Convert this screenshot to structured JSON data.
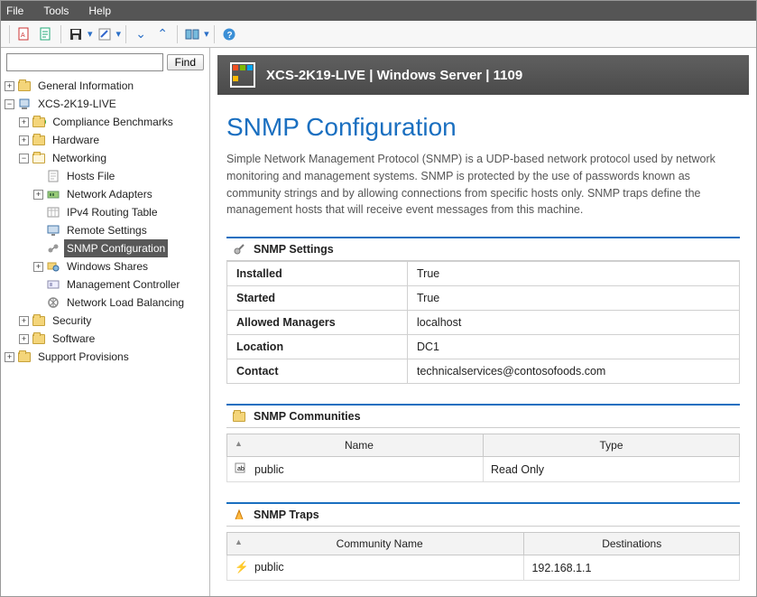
{
  "menu": {
    "file": "File",
    "tools": "Tools",
    "help": "Help"
  },
  "search": {
    "placeholder": "",
    "find_label": "Find"
  },
  "tree": {
    "general_info": "General Information",
    "host": "XCS-2K19-LIVE",
    "compliance": "Compliance Benchmarks",
    "hardware": "Hardware",
    "networking": "Networking",
    "hosts_file": "Hosts File",
    "net_adapters": "Network Adapters",
    "ipv4_routing": "IPv4 Routing Table",
    "remote_settings": "Remote Settings",
    "snmp_config": "SNMP Configuration",
    "windows_shares": "Windows Shares",
    "mgmt_controller": "Management Controller",
    "nlb": "Network Load Balancing",
    "security": "Security",
    "software": "Software",
    "support": "Support Provisions"
  },
  "header": {
    "title": "XCS-2K19-LIVE | Windows Server | 1109"
  },
  "page": {
    "title": "SNMP Configuration",
    "description": "Simple Network Management Protocol (SNMP) is a UDP-based network protocol used by network monitoring and management systems. SNMP is protected by the use of passwords known as community strings and by allowing connections from specific hosts only. SNMP traps define the management hosts that will receive event messages from this machine."
  },
  "settings_section": {
    "title": "SNMP Settings",
    "rows": {
      "installed_k": "Installed",
      "installed_v": "True",
      "started_k": "Started",
      "started_v": "True",
      "allowed_k": "Allowed Managers",
      "allowed_v": "localhost",
      "location_k": "Location",
      "location_v": "DC1",
      "contact_k": "Contact",
      "contact_v": "technicalservices@contosofoods.com"
    }
  },
  "communities_section": {
    "title": "SNMP Communities",
    "cols": {
      "name": "Name",
      "type": "Type"
    },
    "row0": {
      "name": "public",
      "type": "Read Only"
    }
  },
  "traps_section": {
    "title": "SNMP Traps",
    "cols": {
      "cname": "Community Name",
      "dest": "Destinations"
    },
    "row0": {
      "cname": "public",
      "dest": "192.168.1.1"
    }
  }
}
